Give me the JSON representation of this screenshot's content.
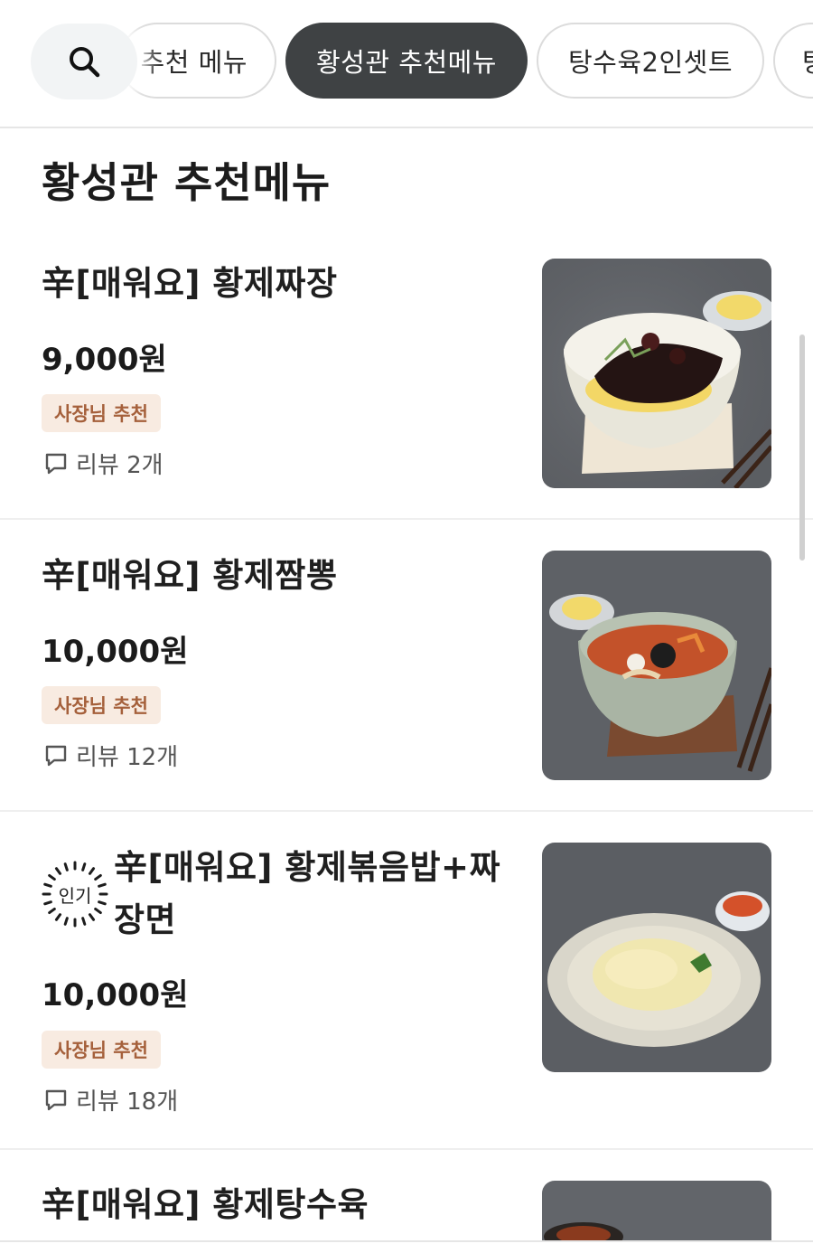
{
  "tabs": [
    {
      "label": "추천 메뉴",
      "active": false
    },
    {
      "label": "황성관 추천메뉴",
      "active": true
    },
    {
      "label": "탕수육2인셋트",
      "active": false
    },
    {
      "label": "탕",
      "active": false
    }
  ],
  "section": {
    "title": "황성관 추천메뉴"
  },
  "items": [
    {
      "name": "辛[매워요] 황제짜장",
      "price": "9,000원",
      "badge": "사장님 추천",
      "reviews": "리뷰 2개",
      "popular": false
    },
    {
      "name": "辛[매워요] 황제짬뽕",
      "price": "10,000원",
      "badge": "사장님 추천",
      "reviews": "리뷰 12개",
      "popular": false
    },
    {
      "name_line1": "辛[매워요] 황제볶음밥+짜",
      "name_line2": "장면",
      "price": "10,000원",
      "badge": "사장님 추천",
      "reviews": "리뷰 18개",
      "popular": true,
      "popular_label": "인기"
    },
    {
      "name": "辛[매워요] 황제탕수육",
      "popular": false
    }
  ],
  "icons": {
    "search": "search-icon",
    "review": "speech-bubble-icon",
    "popular": "popular-burst-icon"
  },
  "colors": {
    "active_chip": "#3f4244",
    "badge_bg": "#f8ebe1",
    "badge_text": "#a5603b"
  }
}
